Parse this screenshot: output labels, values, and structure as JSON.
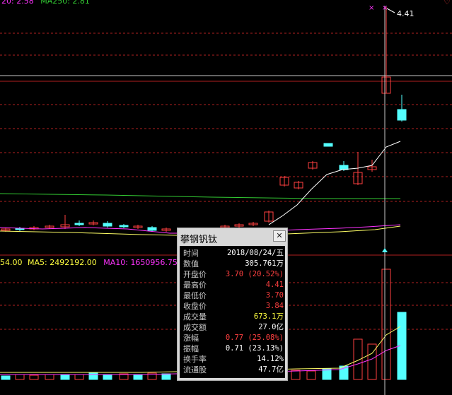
{
  "legend_top": {
    "ma20_label": "20:",
    "ma20_value": "2.58",
    "ma250_label": "MA250:",
    "ma250_value": "2.81"
  },
  "legend_vol": {
    "vol_value": "54.00",
    "ma5_label": "MA5:",
    "ma5_value": "2492192.00",
    "ma10_label": "MA10:",
    "ma10_value": "1650956.75"
  },
  "high_marker": "4.41",
  "tooltip": {
    "title": "攀钢钒钛",
    "rows": [
      {
        "label": "时间",
        "value": "2018/08/24/五",
        "color": "#ffffff"
      },
      {
        "label": "数值",
        "value": "305.761万",
        "color": "#ffffff"
      },
      {
        "label": "开盘价",
        "value": "3.70 (20.52%)",
        "color": "#ff4040"
      },
      {
        "label": "最高价",
        "value": "4.41",
        "color": "#ff4040"
      },
      {
        "label": "最低价",
        "value": "3.70",
        "color": "#ff4040"
      },
      {
        "label": "收盘价",
        "value": "3.84",
        "color": "#ff4040"
      },
      {
        "label": "成交量",
        "value": "673.1万",
        "color": "#ffff40"
      },
      {
        "label": "成交额",
        "value": "27.0亿",
        "color": "#ffffff"
      },
      {
        "label": "涨幅",
        "value": "0.77 (25.08%)",
        "color": "#ff4040"
      },
      {
        "label": "振幅",
        "value": "0.71 (23.13%)",
        "color": "#ffffff"
      },
      {
        "label": "换手率",
        "value": "14.12%",
        "color": "#ffffff"
      },
      {
        "label": "流通股",
        "value": "47.7亿",
        "color": "#ffffff"
      }
    ]
  },
  "colors": {
    "up": "#ff4040",
    "down": "#54ffff",
    "ma20": "#ff33ff",
    "ma250": "#33cc33",
    "ma5": "#ffffff",
    "ma10": "#ffff66",
    "grid": "#b02020"
  }
}
